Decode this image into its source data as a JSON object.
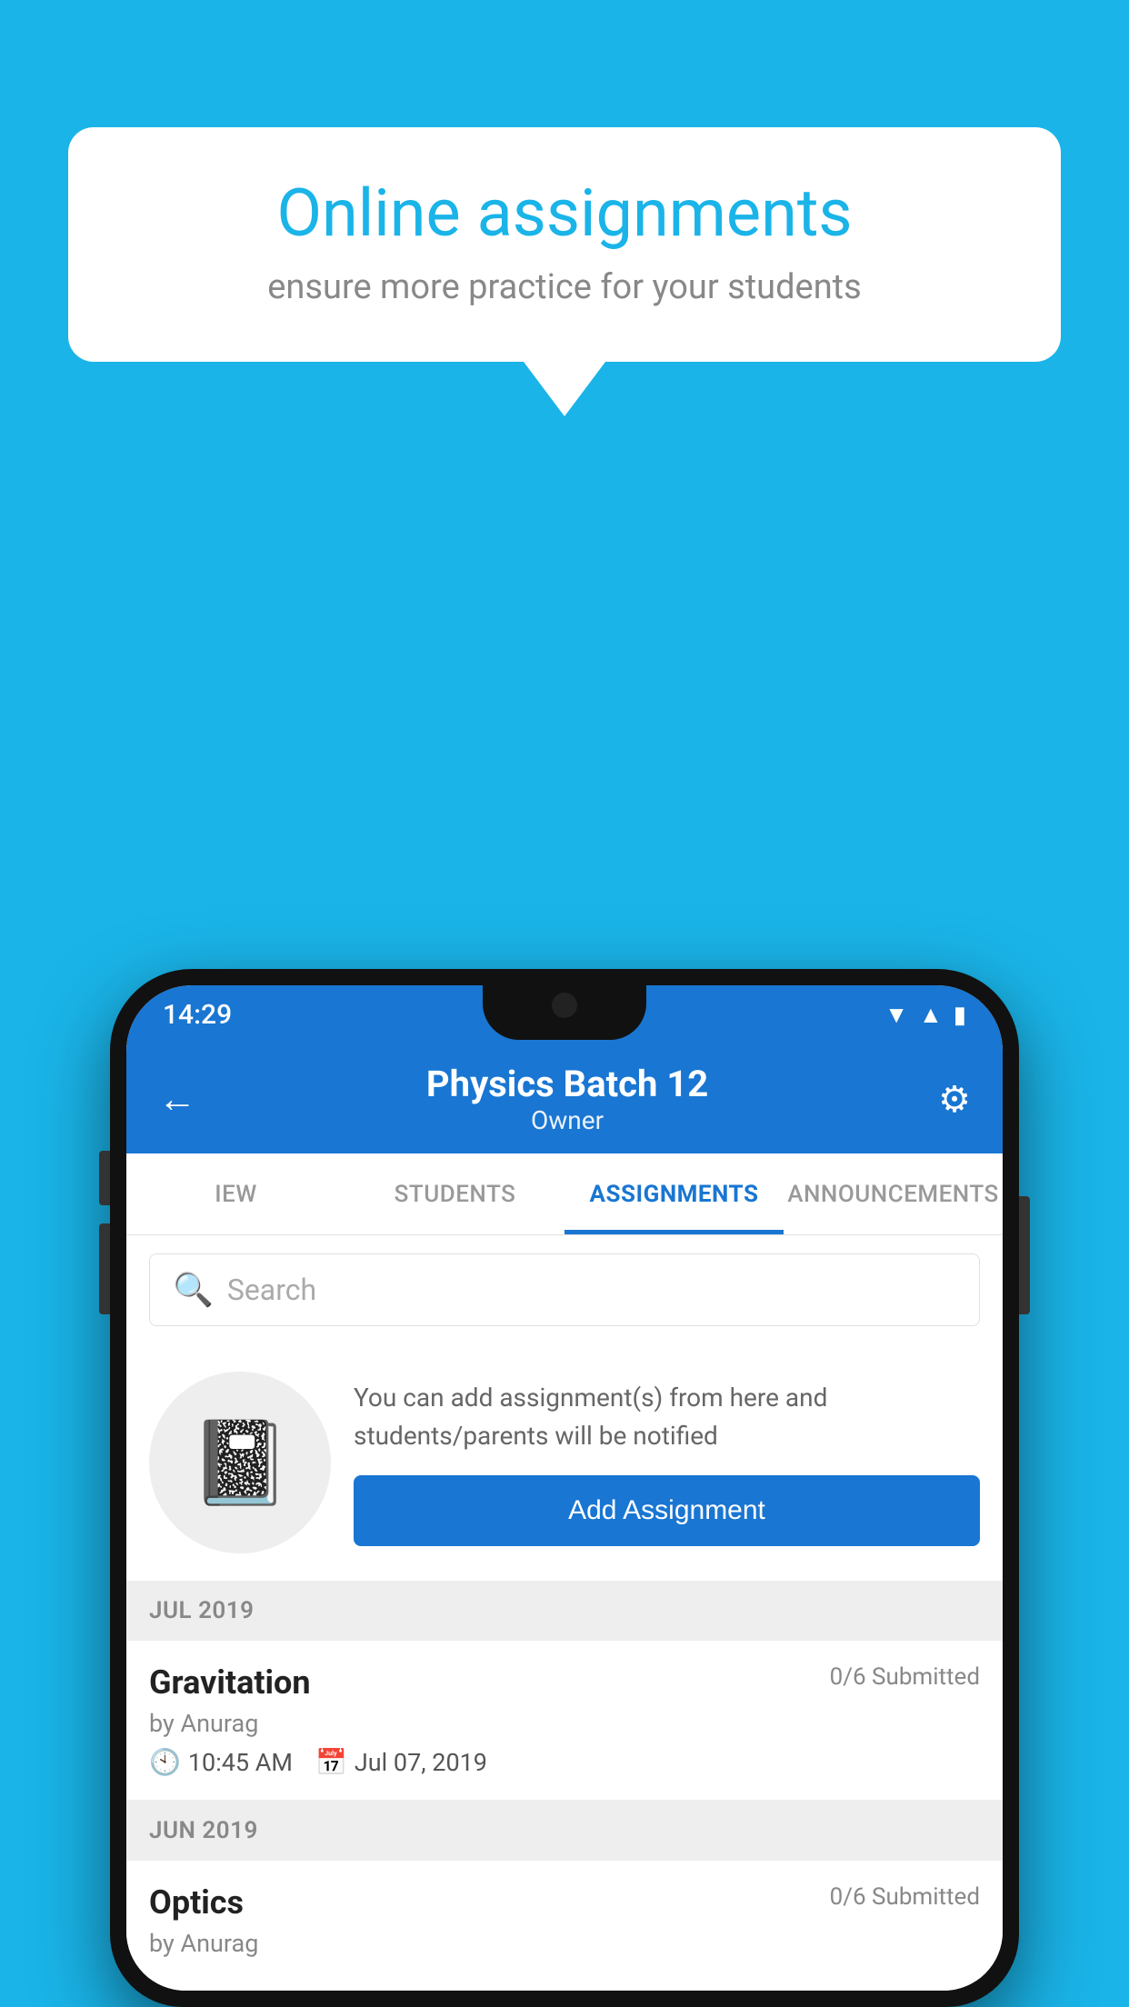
{
  "background_color": "#1ab4e8",
  "speech_bubble": {
    "title": "Online assignments",
    "subtitle": "ensure more practice for your students"
  },
  "phone": {
    "status_bar": {
      "time": "14:29",
      "icons": [
        "wifi",
        "signal",
        "battery"
      ]
    },
    "header": {
      "title": "Physics Batch 12",
      "subtitle": "Owner",
      "back_label": "←",
      "gear_label": "⚙"
    },
    "tabs": [
      {
        "label": "IEW",
        "active": false
      },
      {
        "label": "STUDENTS",
        "active": false
      },
      {
        "label": "ASSIGNMENTS",
        "active": true
      },
      {
        "label": "ANNOUNCEMENTS",
        "active": false
      }
    ],
    "search": {
      "placeholder": "Search"
    },
    "promo": {
      "icon": "📓",
      "description": "You can add assignment(s) from here and students/parents will be notified",
      "button_label": "Add Assignment"
    },
    "sections": [
      {
        "header": "JUL 2019",
        "assignments": [
          {
            "title": "Gravitation",
            "submitted": "0/6 Submitted",
            "by": "by Anurag",
            "time": "10:45 AM",
            "date": "Jul 07, 2019"
          }
        ]
      },
      {
        "header": "JUN 2019",
        "assignments": [
          {
            "title": "Optics",
            "submitted": "0/6 Submitted",
            "by": "by Anurag",
            "time": "",
            "date": ""
          }
        ]
      }
    ]
  }
}
